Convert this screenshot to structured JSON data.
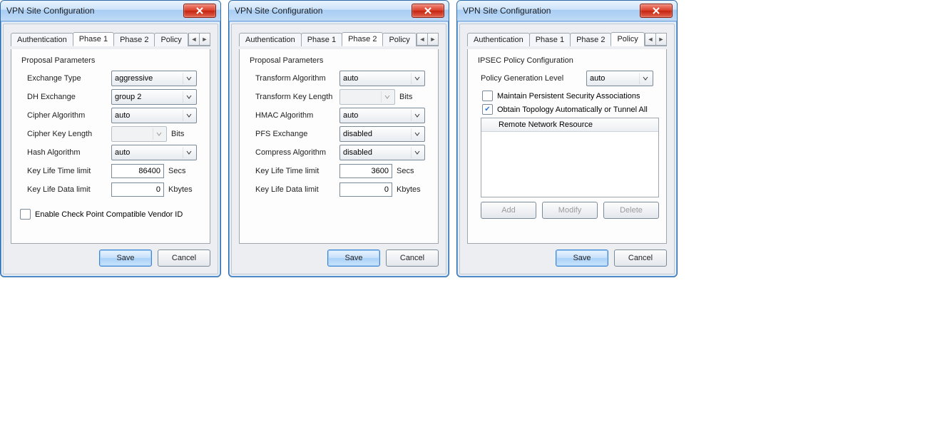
{
  "windows": [
    {
      "title": "VPN Site Configuration",
      "activeTab": "Phase 1",
      "tabs": [
        "Authentication",
        "Phase 1",
        "Phase 2",
        "Policy"
      ],
      "group": "Proposal Parameters",
      "fields": {
        "exchange_type": {
          "label": "Exchange Type",
          "value": "aggressive"
        },
        "dh_exchange": {
          "label": "DH Exchange",
          "value": "group 2"
        },
        "cipher_alg": {
          "label": "Cipher Algorithm",
          "value": "auto"
        },
        "cipher_key_len": {
          "label": "Cipher Key Length",
          "value": "",
          "unit": "Bits"
        },
        "hash_alg": {
          "label": "Hash Algorithm",
          "value": "auto"
        },
        "key_life_time": {
          "label": "Key Life Time limit",
          "value": "86400",
          "unit": "Secs"
        },
        "key_life_data": {
          "label": "Key Life Data limit",
          "value": "0",
          "unit": "Kbytes"
        }
      },
      "checkbox": {
        "label": "Enable Check Point Compatible Vendor ID",
        "checked": false
      },
      "buttons": {
        "save": "Save",
        "cancel": "Cancel"
      }
    },
    {
      "title": "VPN Site Configuration",
      "activeTab": "Phase 2",
      "tabs": [
        "Authentication",
        "Phase 1",
        "Phase 2",
        "Policy"
      ],
      "group": "Proposal Parameters",
      "fields": {
        "trans_alg": {
          "label": "Transform Algorithm",
          "value": "auto"
        },
        "trans_key_len": {
          "label": "Transform Key Length",
          "value": "",
          "unit": "Bits"
        },
        "hmac_alg": {
          "label": "HMAC Algorithm",
          "value": "auto"
        },
        "pfs_exchange": {
          "label": "PFS Exchange",
          "value": "disabled"
        },
        "compress_alg": {
          "label": "Compress Algorithm",
          "value": "disabled"
        },
        "key_life_time": {
          "label": "Key Life Time limit",
          "value": "3600",
          "unit": "Secs"
        },
        "key_life_data": {
          "label": "Key Life Data limit",
          "value": "0",
          "unit": "Kbytes"
        }
      },
      "buttons": {
        "save": "Save",
        "cancel": "Cancel"
      }
    },
    {
      "title": "VPN Site Configuration",
      "activeTab": "Policy",
      "tabs": [
        "Authentication",
        "Phase 1",
        "Phase 2",
        "Policy"
      ],
      "group": "IPSEC Policy Configuration",
      "policy": {
        "gen_label": "Policy Generation Level",
        "gen_value": "auto",
        "chk_persist": {
          "label": "Maintain Persistent Security Associations",
          "checked": false
        },
        "chk_topology": {
          "label": "Obtain Topology Automatically or Tunnel All",
          "checked": true
        },
        "list_header": "Remote Network Resource",
        "btn_add": "Add",
        "btn_modify": "Modify",
        "btn_delete": "Delete"
      },
      "buttons": {
        "save": "Save",
        "cancel": "Cancel"
      }
    }
  ]
}
